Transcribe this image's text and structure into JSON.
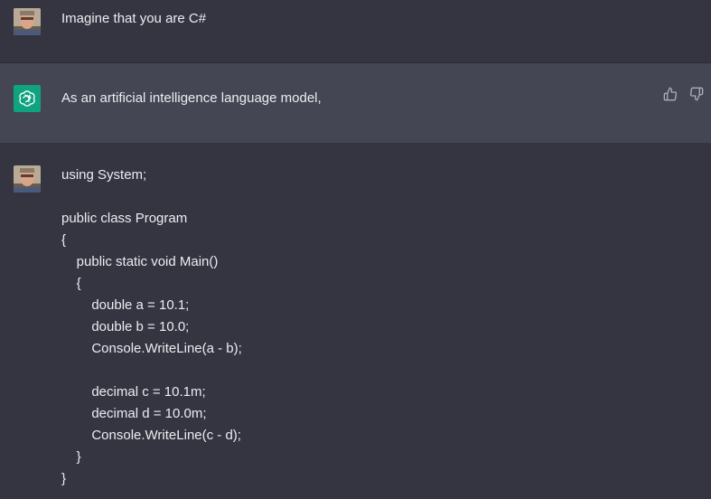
{
  "conversation": {
    "user_message": "Imagine that you are C#",
    "assistant_message": "As an artificial intelligence language model,",
    "code_lines": [
      "using System;",
      "",
      "public class Program",
      "{",
      "    public static void Main()",
      "    {",
      "        double a = 10.1;",
      "        double b = 10.0;",
      "        Console.WriteLine(a - b);",
      "",
      "        decimal c = 10.1m;",
      "        decimal d = 10.0m;",
      "        Console.WriteLine(c - d);",
      "    }",
      "}"
    ]
  },
  "icons": {
    "user_avatar": "user-avatar-photo",
    "assistant_avatar": "openai-logo",
    "thumbs_up": "thumbs-up-icon",
    "thumbs_down": "thumbs-down-icon"
  },
  "colors": {
    "background": "#343541",
    "assistant_background": "#444654",
    "gpt_green": "#10a37f",
    "text": "#ececf1",
    "icon": "#acacbe"
  }
}
